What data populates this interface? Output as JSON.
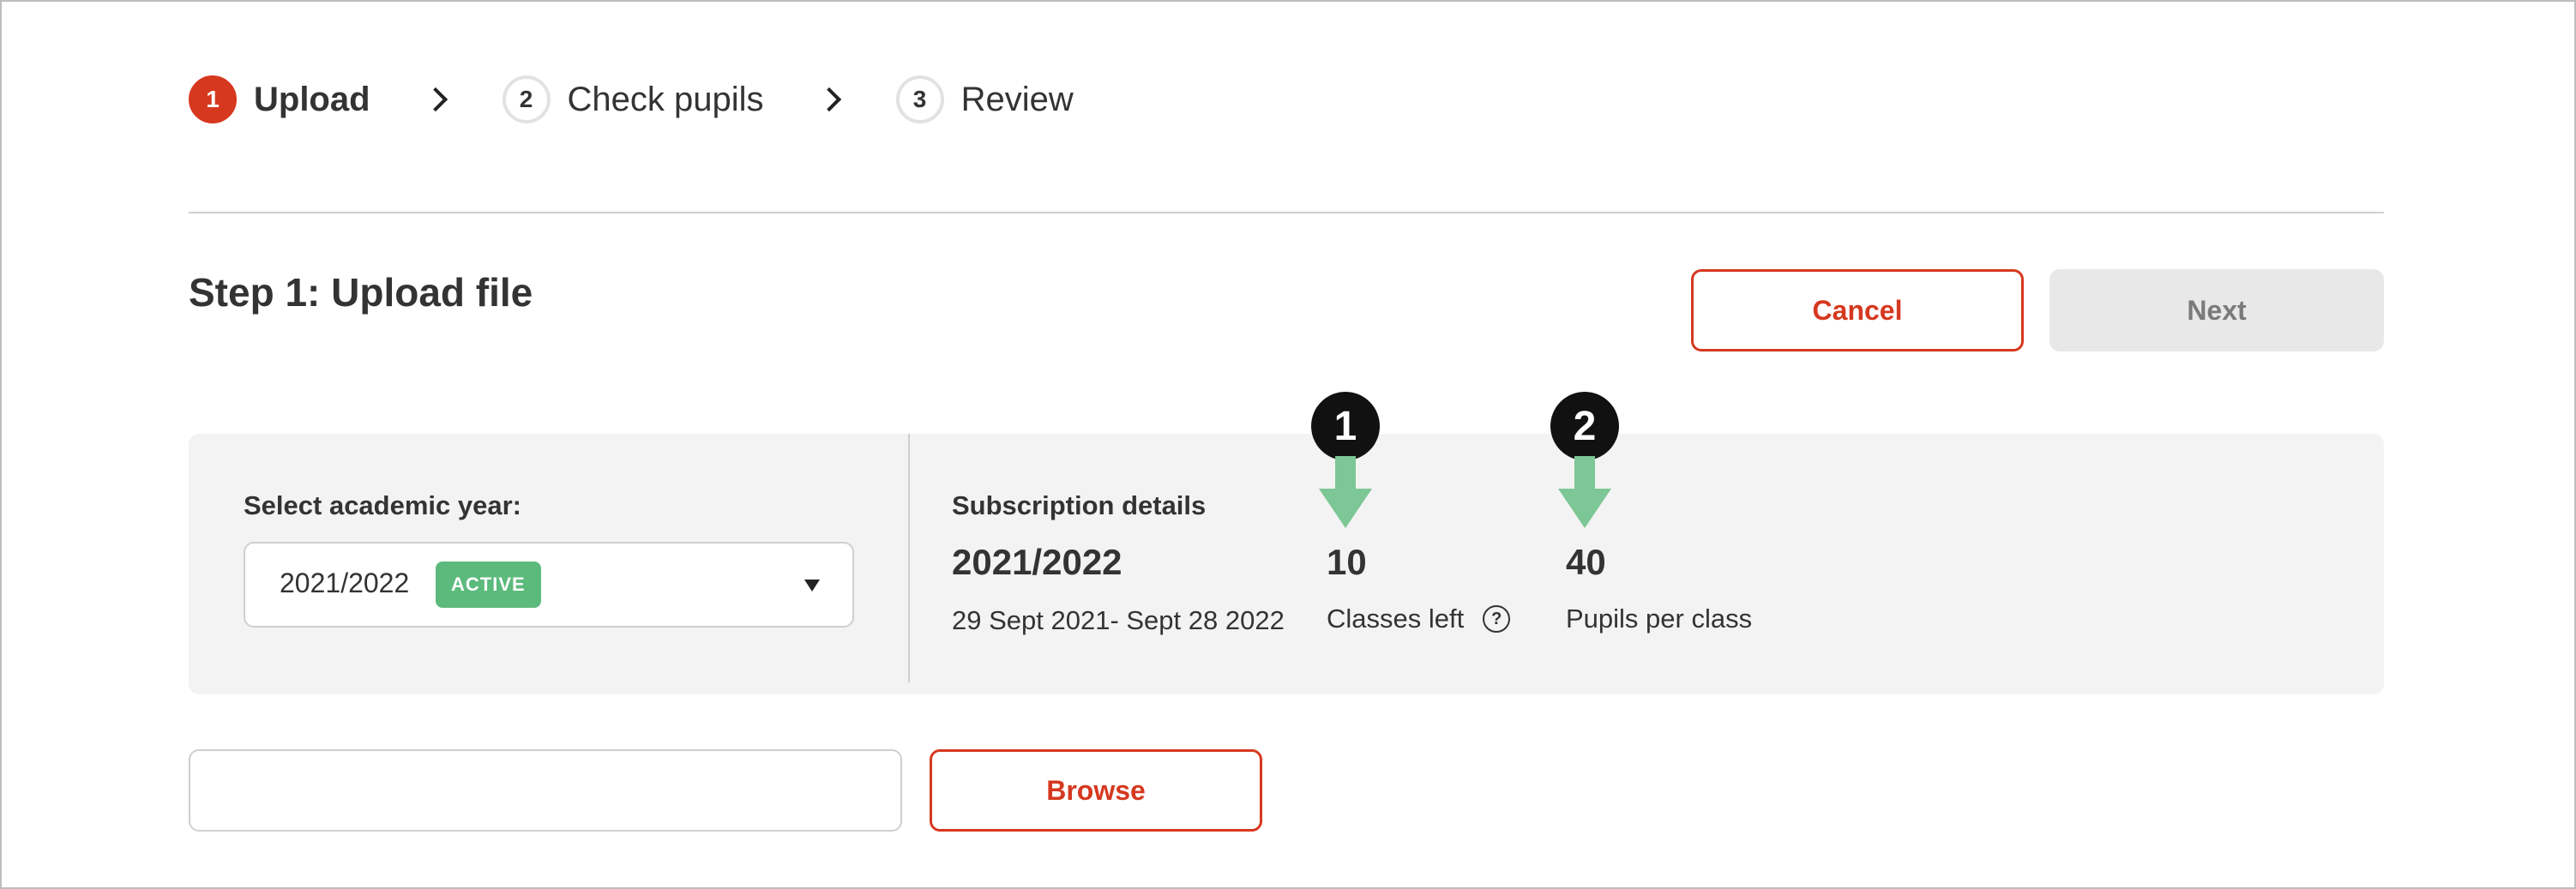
{
  "stepper": {
    "steps": [
      {
        "number": "1",
        "label": "Upload",
        "active": true
      },
      {
        "number": "2",
        "label": "Check pupils",
        "active": false
      },
      {
        "number": "3",
        "label": "Review",
        "active": false
      }
    ]
  },
  "page": {
    "title": "Step 1: Upload file"
  },
  "actions": {
    "cancel_label": "Cancel",
    "next_label": "Next"
  },
  "academic_year": {
    "label": "Select academic year:",
    "selected": "2021/2022",
    "badge": "ACTIVE"
  },
  "subscription": {
    "title": "Subscription details",
    "year": "2021/2022",
    "dates": "29 Sept 2021- Sept 28 2022",
    "classes_left_value": "10",
    "classes_left_label": "Classes left",
    "pupils_per_class_value": "40",
    "pupils_per_class_label": "Pupils per class"
  },
  "callouts": {
    "first": "1",
    "second": "2"
  },
  "upload": {
    "file_value": "",
    "browse_label": "Browse"
  },
  "colors": {
    "accent": "#d6381f",
    "badge": "#5cba7c",
    "arrow": "#7cc795",
    "callout": "#111111"
  },
  "icons": {
    "help": "question-circle-icon",
    "dropdown": "caret-down-icon",
    "step_separator": "chevron-right-icon"
  }
}
